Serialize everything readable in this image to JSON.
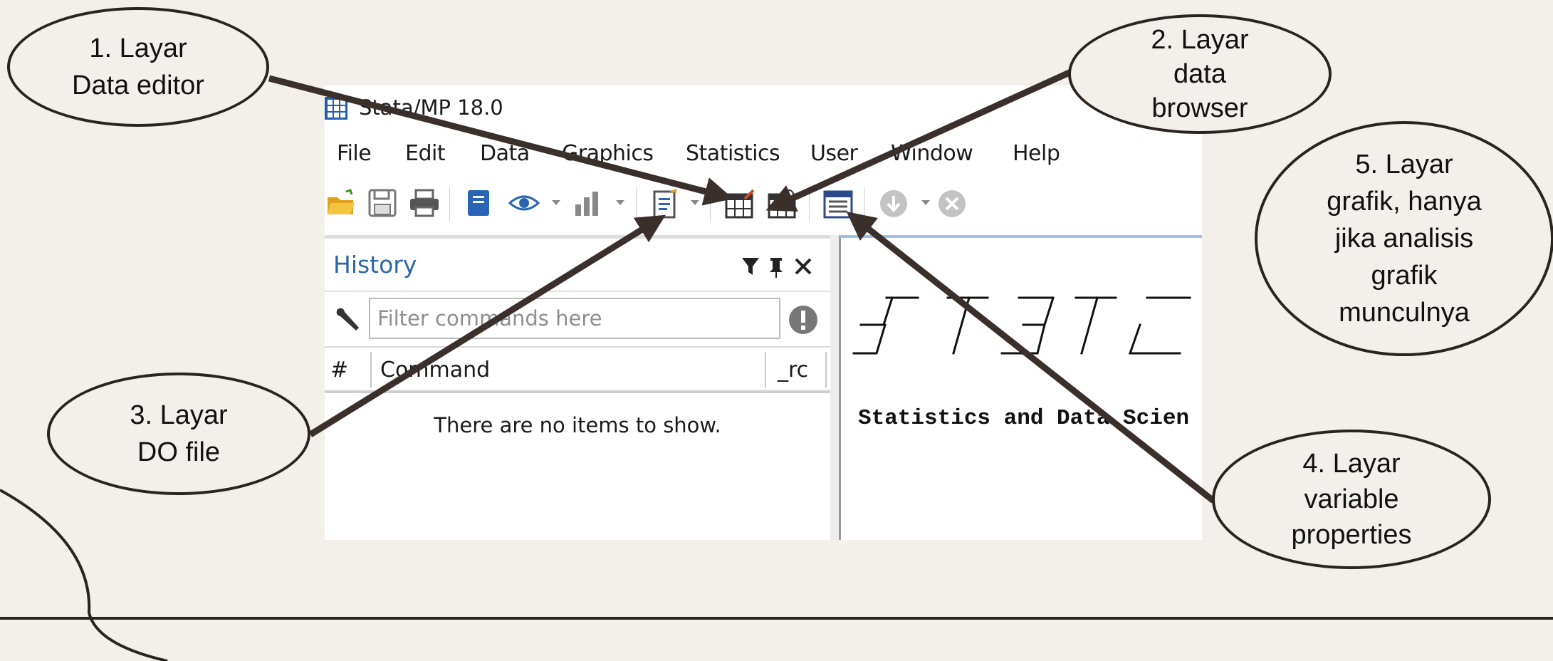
{
  "window": {
    "title": "Stata/MP 18.0"
  },
  "menu": [
    "File",
    "Edit",
    "Data",
    "Graphics",
    "Statistics",
    "User",
    "Window",
    "Help"
  ],
  "toolbar": {
    "icons": [
      "open-folder-icon",
      "save-icon",
      "print-icon",
      "log-icon",
      "viewer-icon",
      "graph-icon",
      "do-file-editor-icon",
      "data-editor-icon",
      "data-browser-icon",
      "variables-manager-icon",
      "more-icon",
      "break-icon"
    ]
  },
  "history": {
    "title": "History",
    "filter_placeholder": "Filter commands here",
    "columns": [
      "#",
      "Command",
      "_rc"
    ],
    "empty_message": "There are no items to show."
  },
  "results": {
    "tagline": "Statistics and Data Scien"
  },
  "callouts": [
    {
      "lines": [
        "1. Layar",
        "Data editor"
      ]
    },
    {
      "lines": [
        "2. Layar",
        "data",
        "browser"
      ]
    },
    {
      "lines": [
        "3. Layar",
        "DO file"
      ]
    },
    {
      "lines": [
        "4. Layar",
        "variable",
        "properties"
      ]
    },
    {
      "lines": [
        "5. Layar",
        "grafik, hanya",
        "jika analisis",
        "grafik",
        "munculnya"
      ]
    }
  ],
  "colors": {
    "background": "#f3f0ec",
    "history_title": "#2c65a6",
    "arrow": "#3a2f2a"
  }
}
